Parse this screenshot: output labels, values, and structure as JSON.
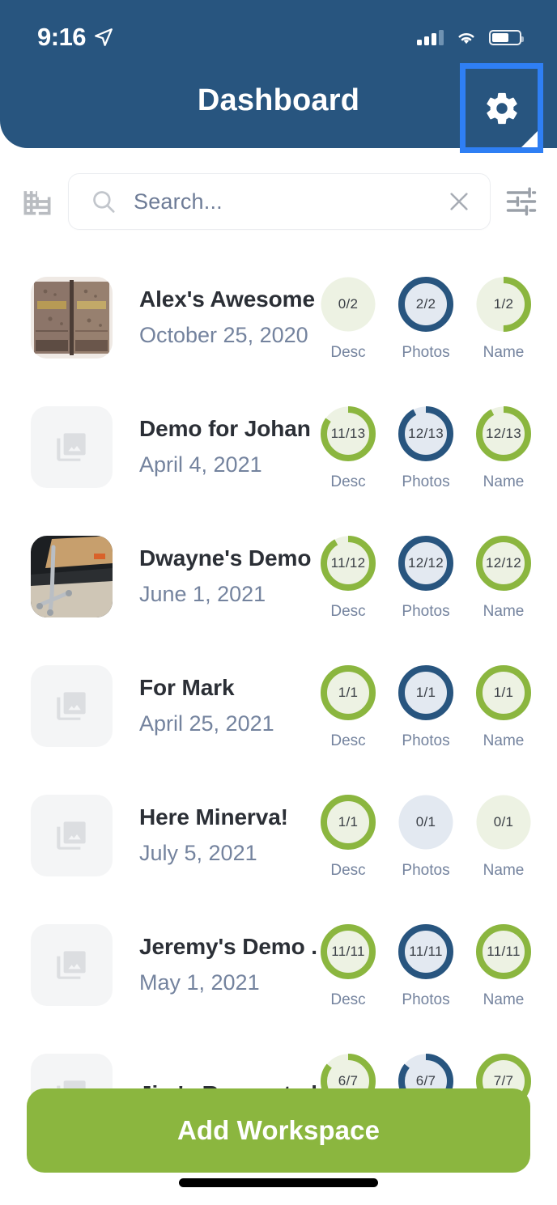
{
  "statusbar": {
    "time": "9:16",
    "location_icon": "location-arrow-icon",
    "signal_icon": "cellular-signal-icon",
    "wifi_icon": "wifi-icon",
    "battery_icon": "battery-icon",
    "battery_level": "62%"
  },
  "header": {
    "title": "Dashboard",
    "background_color": "#28557F",
    "settings_icon": "gear-icon",
    "highlight_color": "#2F7FF4"
  },
  "search": {
    "workspace_icon": "building-icon",
    "search_icon": "search-icon",
    "placeholder": "Search...",
    "value": "",
    "clear_icon": "close-x-icon",
    "filter_icon": "filter-sliders-icon"
  },
  "list": {
    "ring_captions": [
      "Desc",
      "Photos",
      "Name"
    ],
    "colors": {
      "green": "#8BB63F",
      "green_track": "#EDF2E3",
      "blue": "#28557F",
      "blue_track": "#E3E9F1"
    },
    "rows": [
      {
        "title": "Alex's Awesome ...",
        "date": "October 25, 2020",
        "thumb": "photo-book",
        "rings": [
          {
            "caption": "Desc",
            "label": "0/2",
            "value": 0,
            "total": 2,
            "color": "green"
          },
          {
            "caption": "Photos",
            "label": "2/2",
            "value": 2,
            "total": 2,
            "color": "blue"
          },
          {
            "caption": "Name",
            "label": "1/2",
            "value": 1,
            "total": 2,
            "color": "green"
          }
        ]
      },
      {
        "title": "Demo for Johan",
        "date": "April 4, 2021",
        "thumb": "placeholder",
        "rings": [
          {
            "caption": "Desc",
            "label": "11/13",
            "value": 11,
            "total": 13,
            "color": "green"
          },
          {
            "caption": "Photos",
            "label": "12/13",
            "value": 12,
            "total": 13,
            "color": "blue"
          },
          {
            "caption": "Name",
            "label": "12/13",
            "value": 12,
            "total": 13,
            "color": "green"
          }
        ]
      },
      {
        "title": "Dwayne's Demo",
        "date": "June 1, 2021",
        "thumb": "photo-stand",
        "rings": [
          {
            "caption": "Desc",
            "label": "11/12",
            "value": 11,
            "total": 12,
            "color": "green"
          },
          {
            "caption": "Photos",
            "label": "12/12",
            "value": 12,
            "total": 12,
            "color": "blue"
          },
          {
            "caption": "Name",
            "label": "12/12",
            "value": 12,
            "total": 12,
            "color": "green"
          }
        ]
      },
      {
        "title": "For Mark",
        "date": "April 25, 2021",
        "thumb": "placeholder",
        "rings": [
          {
            "caption": "Desc",
            "label": "1/1",
            "value": 1,
            "total": 1,
            "color": "green"
          },
          {
            "caption": "Photos",
            "label": "1/1",
            "value": 1,
            "total": 1,
            "color": "blue"
          },
          {
            "caption": "Name",
            "label": "1/1",
            "value": 1,
            "total": 1,
            "color": "green"
          }
        ]
      },
      {
        "title": "Here Minerva!",
        "date": "July 5, 2021",
        "thumb": "placeholder",
        "rings": [
          {
            "caption": "Desc",
            "label": "1/1",
            "value": 1,
            "total": 1,
            "color": "green"
          },
          {
            "caption": "Photos",
            "label": "0/1",
            "value": 0,
            "total": 1,
            "color": "blue"
          },
          {
            "caption": "Name",
            "label": "0/1",
            "value": 0,
            "total": 1,
            "color": "green"
          }
        ]
      },
      {
        "title": "Jeremy's Demo ...",
        "date": "May 1, 2021",
        "thumb": "placeholder",
        "rings": [
          {
            "caption": "Desc",
            "label": "11/11",
            "value": 11,
            "total": 11,
            "color": "green"
          },
          {
            "caption": "Photos",
            "label": "11/11",
            "value": 11,
            "total": 11,
            "color": "blue"
          },
          {
            "caption": "Name",
            "label": "11/11",
            "value": 11,
            "total": 11,
            "color": "green"
          }
        ]
      },
      {
        "title": "Jim's Requested ...",
        "date": "",
        "thumb": "placeholder",
        "rings": [
          {
            "caption": "Desc",
            "label": "6/7",
            "value": 6,
            "total": 7,
            "color": "green"
          },
          {
            "caption": "Photos",
            "label": "6/7",
            "value": 6,
            "total": 7,
            "color": "blue"
          },
          {
            "caption": "Name",
            "label": "7/7",
            "value": 7,
            "total": 7,
            "color": "green"
          }
        ]
      }
    ]
  },
  "footer": {
    "add_button_label": "Add Workspace",
    "add_button_color": "#8BB63F",
    "home_indicator": "home-indicator"
  }
}
